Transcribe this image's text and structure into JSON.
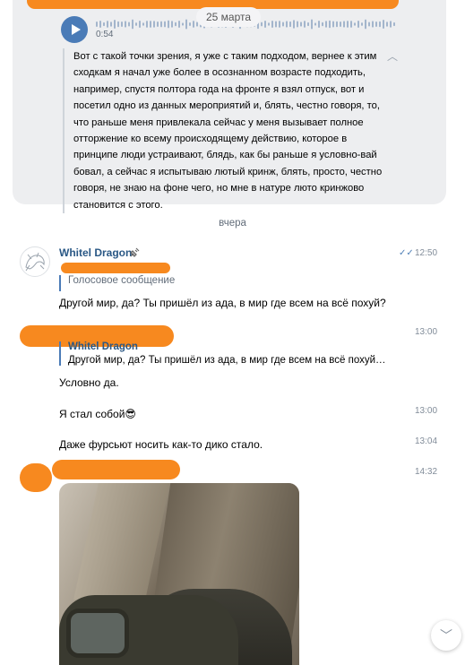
{
  "voice_message": {
    "date": "25 марта",
    "duration": "0:54",
    "transcript": "Вот с такой точки зрения, я уже с таким подходом, вернее к этим сходкам я начал уже более в осознанном возрасте подходить, например, спустя полтора года на фронте я взял отпуск, вот и посетил одно из данных мероприятий и, блять, честно говоря, то, что раньше меня привлекала сейчас у меня вызывает полное отторжение ко всему происходящему действию, которое в принципе люди устраивают, блядь, как бы раньше я условно-вай бовал, а сейчас я испытываю лютый кринж, блять, просто, честно говоря, не знаю на фоне чего, но мне в натуре люто кринжово становится с этого."
  },
  "day_separator": "вчера",
  "messages": [
    {
      "sender": "Whitel Dragon",
      "time": "12:50",
      "reply_label": "Голосовое сообщение",
      "text": "Другой мир, да? Ты пришёл из ада, в мир где всем на всё похуй?"
    },
    {
      "time": "13:00",
      "quote_name": "Whitel Dragon",
      "quote_text": "Другой мир, да? Ты пришёл из ада, в мир где всем на всё похуй…",
      "text": "Условно да."
    },
    {
      "time": "13:00",
      "text": "Я стал собой😎"
    },
    {
      "time": "13:04",
      "text": "Даже фурсьют носить как-то дико стало."
    },
    {
      "time": "14:32"
    }
  ],
  "icons": {
    "play": "play-icon",
    "collapse": "chevron-up-icon",
    "read": "double-check-icon",
    "scroll_down": "chevron-down-icon",
    "badge": "satellite-icon"
  },
  "colors": {
    "accent": "#4a7bb7",
    "link": "#2a5885",
    "redaction": "#f7891f"
  }
}
